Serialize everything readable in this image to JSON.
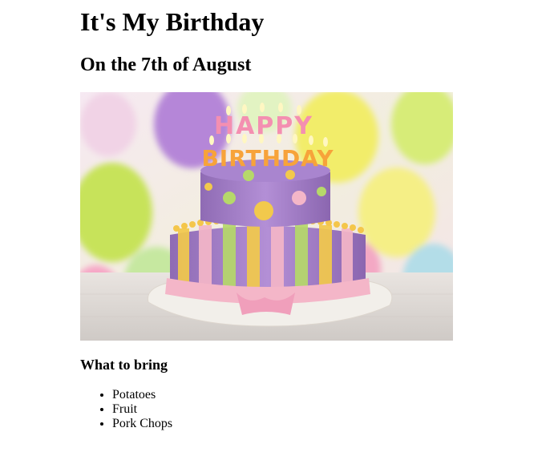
{
  "page": {
    "title": "It's My Birthday",
    "subtitle": "On the 7th of August",
    "image": {
      "alt": "Birthday cake with Happy Birthday candles",
      "candle_text_top": "HAPPY",
      "candle_text_bottom": "BIRTHDAY"
    },
    "bring_heading": "What to bring",
    "bring_items": [
      "Potatoes",
      "Fruit",
      "Pork Chops"
    ]
  },
  "colors": {
    "cake_purple": "#a884c9",
    "cake_pink": "#f4b6c8",
    "cake_yellow": "#f2c94c",
    "cake_green": "#b6d86a",
    "plate": "#f3efe9"
  }
}
